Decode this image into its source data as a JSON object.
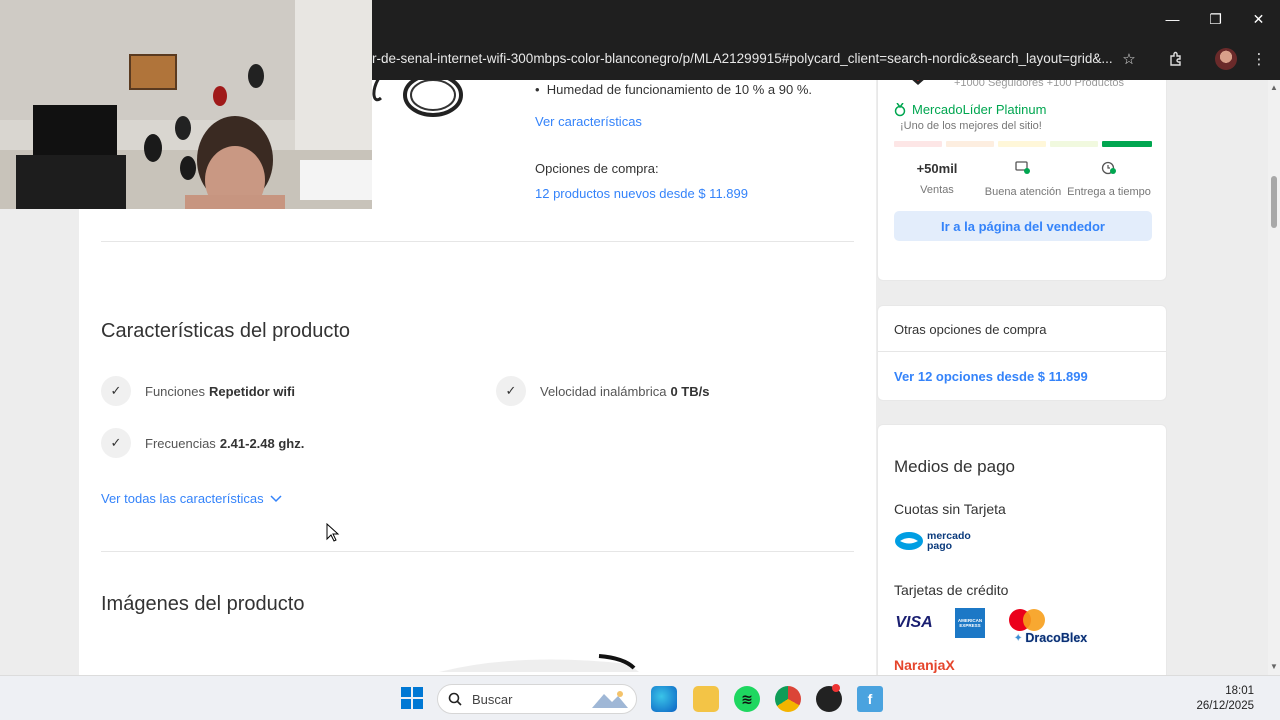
{
  "browser": {
    "url": "r-de-senal-internet-wifi-300mbps-color-blanconegro/p/MLA21299915#polycard_client=search-nordic&search_layout=grid&...",
    "window_controls": {
      "minimize": "—",
      "restore": "❐",
      "close": "✕"
    }
  },
  "product_info": {
    "bullet": "Humedad de funcionamiento de 10 % a 90 %.",
    "ver_caracteristicas": "Ver características",
    "opciones_label": "Opciones de compra:",
    "opciones_link": "12 productos nuevos desde $ 11.899"
  },
  "characteristics": {
    "title": "Características del producto",
    "items": [
      {
        "label": "Funciones",
        "value": "Repetidor wifi"
      },
      {
        "label": "Velocidad inalámbrica",
        "value": "0 TB/s"
      },
      {
        "label": "Frecuencias",
        "value": "2.41-2.48 ghz."
      }
    ],
    "see_all": "Ver todas las características"
  },
  "images_section": {
    "title": "Imágenes del producto"
  },
  "seller": {
    "stats_partial": "+1000 Seguidores   +100 Productos",
    "badge": "MercadoLíder Platinum",
    "badge_sub": "¡Uno de los mejores del sitio!",
    "reputation_level": 5,
    "metrics": [
      {
        "value": "+50mil",
        "label": "Ventas"
      },
      {
        "icon": "chat-check-icon",
        "label": "Buena atención"
      },
      {
        "icon": "clock-check-icon",
        "label": "Entrega a tiempo"
      }
    ],
    "button": "Ir a la página del vendedor"
  },
  "other_options": {
    "title": "Otras opciones de compra",
    "link": "Ver 12 opciones desde $ 11.899"
  },
  "payment": {
    "title": "Medios de pago",
    "cuotas_title": "Cuotas sin Tarjeta",
    "mp_line1": "mercado",
    "mp_line2": "pago",
    "credit_title": "Tarjetas de crédito",
    "cards": [
      "VISA",
      "AMERICAN EXPRESS",
      "DracoBlex",
      "NaranjaX"
    ]
  },
  "taskbar": {
    "search_placeholder": "Buscar",
    "time": "18:01",
    "date": "26/12/2025"
  },
  "colors": {
    "link": "#3483fa",
    "mercadolider_green": "#00a650",
    "chrome_dark": "#1f1f1f"
  }
}
